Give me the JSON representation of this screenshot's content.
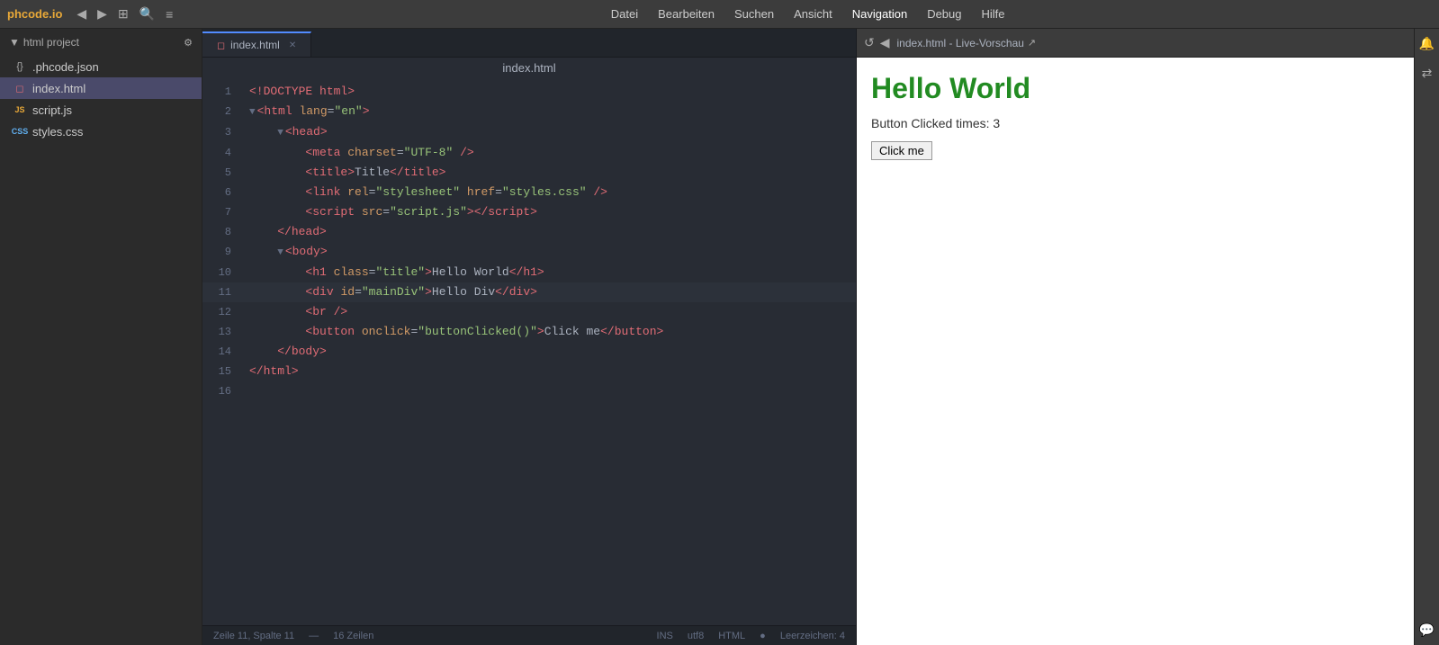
{
  "topbar": {
    "logo": "phcode.io",
    "nav_icons": [
      "◀",
      "▶",
      "⊞",
      "🔍",
      "≡"
    ],
    "menu": [
      "Datei",
      "Bearbeiten",
      "Suchen",
      "Ansicht",
      "Navigation",
      "Debug",
      "Hilfe"
    ]
  },
  "sidebar": {
    "project_label": "html project",
    "files": [
      {
        "name": ".phcode.json",
        "type": "json",
        "icon": "{}"
      },
      {
        "name": "index.html",
        "type": "html",
        "icon": "◻",
        "active": true
      },
      {
        "name": "script.js",
        "type": "js",
        "icon": "JS"
      },
      {
        "name": "styles.css",
        "type": "css",
        "icon": "CSS"
      }
    ]
  },
  "editor": {
    "filename": "index.html",
    "lines": [
      {
        "num": 1,
        "content": "<!DOCTYPE html>",
        "highlighted": false
      },
      {
        "num": 2,
        "content": "<html lang=\"en\">",
        "highlighted": false,
        "collapsible": true
      },
      {
        "num": 3,
        "content": "    <head>",
        "highlighted": false,
        "collapsible": true
      },
      {
        "num": 4,
        "content": "        <meta charset=\"UTF-8\" />",
        "highlighted": false
      },
      {
        "num": 5,
        "content": "        <title>Title</title>",
        "highlighted": false
      },
      {
        "num": 6,
        "content": "        <link rel=\"stylesheet\" href=\"styles.css\" />",
        "highlighted": false
      },
      {
        "num": 7,
        "content": "        <script src=\"script.js\"><\\/script>",
        "highlighted": false
      },
      {
        "num": 8,
        "content": "    </head>",
        "highlighted": false
      },
      {
        "num": 9,
        "content": "    <body>",
        "highlighted": false,
        "collapsible": true
      },
      {
        "num": 10,
        "content": "        <h1 class=\"title\">Hello World</h1>",
        "highlighted": false
      },
      {
        "num": 11,
        "content": "        <div id=\"mainDiv\">Hello Div</div>",
        "highlighted": true
      },
      {
        "num": 12,
        "content": "        <br />",
        "highlighted": false
      },
      {
        "num": 13,
        "content": "        <button onclick=\"buttonClicked()\">Click me</button>",
        "highlighted": false
      },
      {
        "num": 14,
        "content": "    </body>",
        "highlighted": false
      },
      {
        "num": 15,
        "content": "</html>",
        "highlighted": false
      },
      {
        "num": 16,
        "content": "",
        "highlighted": false
      }
    ]
  },
  "preview": {
    "title": "index.html - Live-Vorschau",
    "heading": "Hello World",
    "click_count_label": "Button Clicked times:",
    "click_count": "3",
    "button_label": "Click me"
  },
  "statusbar": {
    "position": "Zeile 11, Spalte 11",
    "lines_info": "16 Zeilen",
    "mode": "INS",
    "encoding": "utf8",
    "language": "HTML",
    "spaces": "Leerzeichen: 4"
  }
}
